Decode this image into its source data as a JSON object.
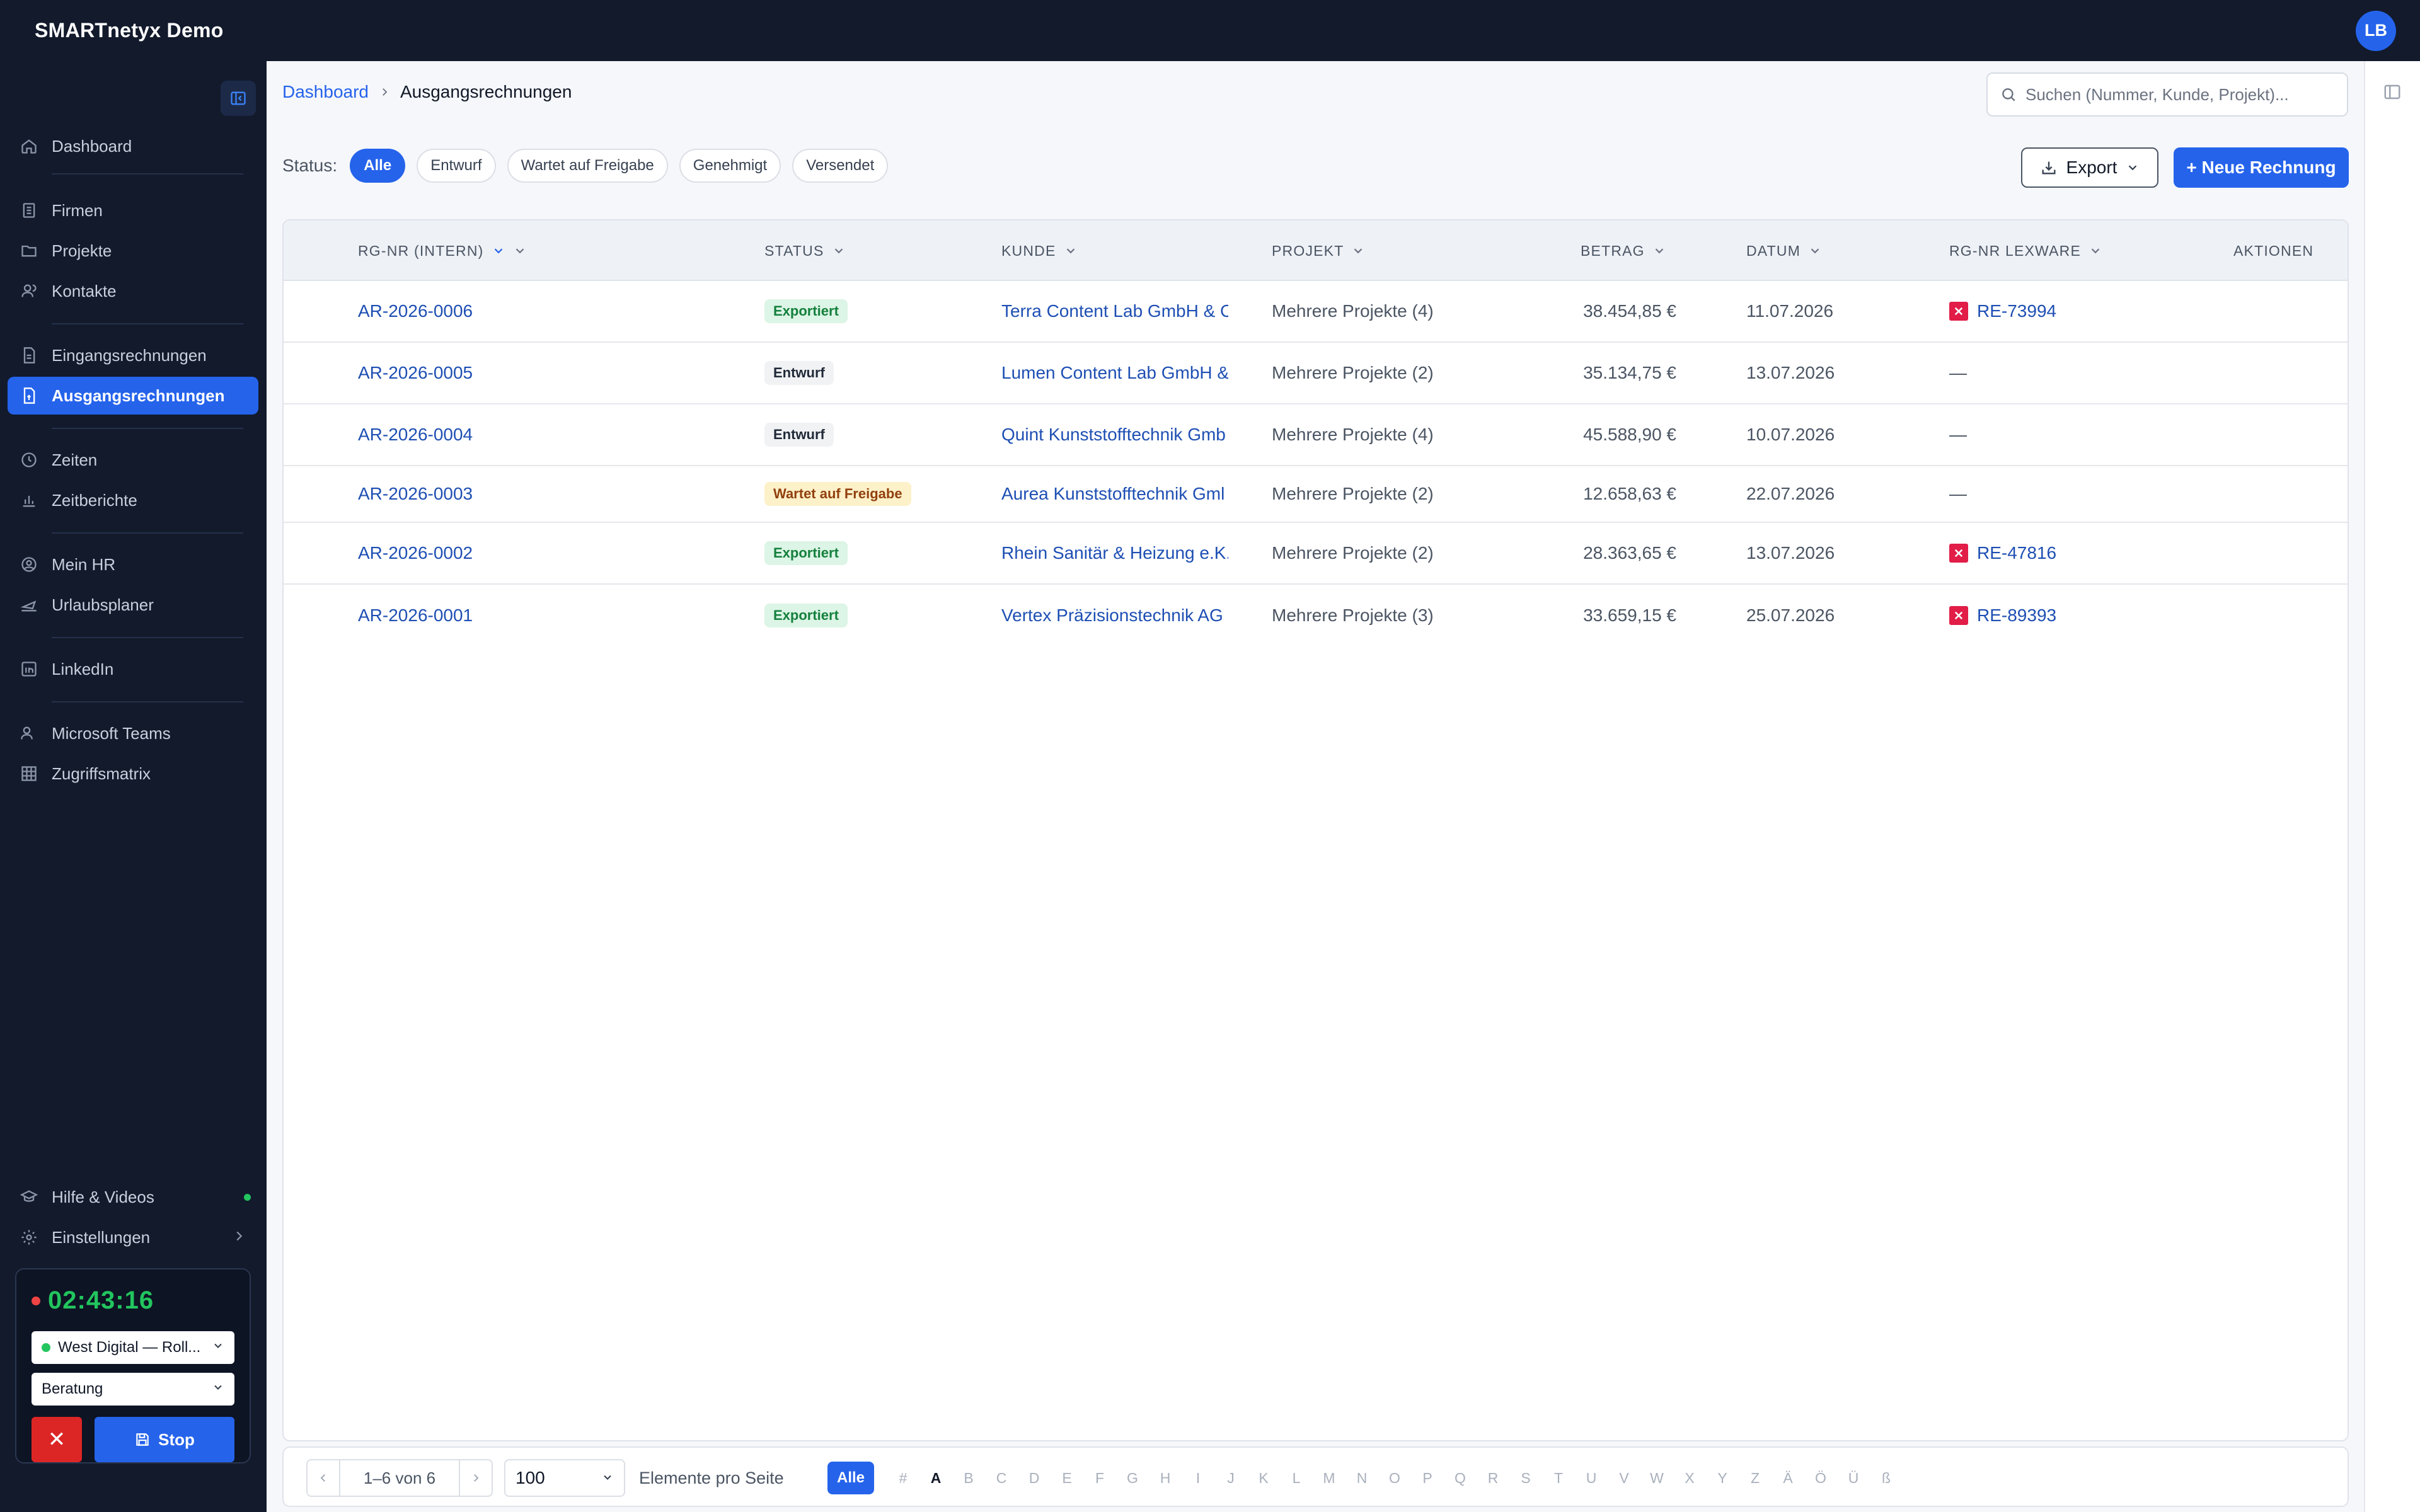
{
  "app": {
    "title": "SMARTnetyx Demo",
    "user_initials": "LB"
  },
  "sidebar": {
    "items": [
      {
        "label": "Dashboard",
        "icon": "home-icon"
      },
      {
        "label": "Firmen",
        "icon": "building-icon"
      },
      {
        "label": "Projekte",
        "icon": "folder-icon"
      },
      {
        "label": "Kontakte",
        "icon": "contacts-icon"
      },
      {
        "label": "Eingangsrechnungen",
        "icon": "invoice-in-icon"
      },
      {
        "label": "Ausgangsrechnungen",
        "icon": "invoice-out-icon",
        "active": true
      },
      {
        "label": "Zeiten",
        "icon": "clock-icon"
      },
      {
        "label": "Zeitberichte",
        "icon": "bar-chart-icon"
      },
      {
        "label": "Mein HR",
        "icon": "user-circle-icon"
      },
      {
        "label": "Urlaubsplaner",
        "icon": "plane-icon"
      },
      {
        "label": "LinkedIn",
        "icon": "linkedin-icon"
      },
      {
        "label": "Microsoft Teams",
        "icon": "teams-icon"
      },
      {
        "label": "Zugriffsmatrix",
        "icon": "grid-icon"
      }
    ],
    "bottom": [
      {
        "label": "Hilfe & Videos",
        "icon": "graduation-cap-icon"
      },
      {
        "label": "Einstellungen",
        "icon": "gear-icon"
      }
    ]
  },
  "timer": {
    "time": "02:43:16",
    "project": "West Digital — Roll...",
    "activity": "Beratung",
    "cancel_label": "✕",
    "stop_label": "Stop"
  },
  "breadcrumb": {
    "parent": "Dashboard",
    "current": "Ausgangsrechnungen"
  },
  "search": {
    "placeholder": "Suchen (Nummer, Kunde, Projekt)..."
  },
  "filters": {
    "label": "Status:",
    "chips": [
      "Alle",
      "Entwurf",
      "Wartet auf Freigabe",
      "Genehmigt",
      "Versendet"
    ],
    "active": "Alle"
  },
  "actions": {
    "export_label": "Export",
    "new_label": "+ Neue Rechnung"
  },
  "table": {
    "columns": {
      "rg": "RG-NR (INTERN)",
      "status": "STATUS",
      "kunde": "KUNDE",
      "projekt": "PROJEKT",
      "betrag": "BETRAG",
      "datum": "DATUM",
      "lexware": "RG-NR LEXWARE",
      "aktionen": "AKTIONEN"
    },
    "rows": [
      {
        "rg": "AR-2026-0006",
        "status": "Exportiert",
        "status_type": "exp",
        "kunde": "Terra Content Lab GmbH & C",
        "projekt": "Mehrere Projekte (4)",
        "betrag": "38.454,85 €",
        "datum": "11.07.2026",
        "lexware": "RE-73994"
      },
      {
        "rg": "AR-2026-0005",
        "status": "Entwurf",
        "status_type": "ent",
        "kunde": "Lumen Content Lab GmbH &",
        "projekt": "Mehrere Projekte (2)",
        "betrag": "35.134,75 €",
        "datum": "13.07.2026",
        "lexware": "—"
      },
      {
        "rg": "AR-2026-0004",
        "status": "Entwurf",
        "status_type": "ent",
        "kunde": "Quint Kunststofftechnik Gmb",
        "projekt": "Mehrere Projekte (4)",
        "betrag": "45.588,90 €",
        "datum": "10.07.2026",
        "lexware": "—"
      },
      {
        "rg": "AR-2026-0003",
        "status": "Wartet auf Freigabe",
        "status_type": "wait",
        "kunde": "Aurea Kunststofftechnik Gml",
        "projekt": "Mehrere Projekte (2)",
        "betrag": "12.658,63 €",
        "datum": "22.07.2026",
        "lexware": "—"
      },
      {
        "rg": "AR-2026-0002",
        "status": "Exportiert",
        "status_type": "exp",
        "kunde": "Rhein Sanitär & Heizung e.K.",
        "projekt": "Mehrere Projekte (2)",
        "betrag": "28.363,65 €",
        "datum": "13.07.2026",
        "lexware": "RE-47816"
      },
      {
        "rg": "AR-2026-0001",
        "status": "Exportiert",
        "status_type": "exp",
        "kunde": "Vertex Präzisionstechnik AG",
        "projekt": "Mehrere Projekte (3)",
        "betrag": "33.659,15 €",
        "datum": "25.07.2026",
        "lexware": "RE-89393"
      }
    ]
  },
  "pagination": {
    "range": "1–6 von 6",
    "per_page": "100",
    "per_page_label": "Elemente pro Seite",
    "alpha_all": "Alle",
    "letters": [
      "#",
      "A",
      "B",
      "C",
      "D",
      "E",
      "F",
      "G",
      "H",
      "I",
      "J",
      "K",
      "L",
      "M",
      "N",
      "O",
      "P",
      "Q",
      "R",
      "S",
      "T",
      "U",
      "V",
      "W",
      "X",
      "Y",
      "Z",
      "Ä",
      "Ö",
      "Ü",
      "ß"
    ],
    "active_letter": "A"
  },
  "colors": {
    "primary": "#2563eb",
    "sidebar_bg": "#121a2c",
    "timer_green": "#22c55e",
    "lexware_red": "#e11d48"
  }
}
